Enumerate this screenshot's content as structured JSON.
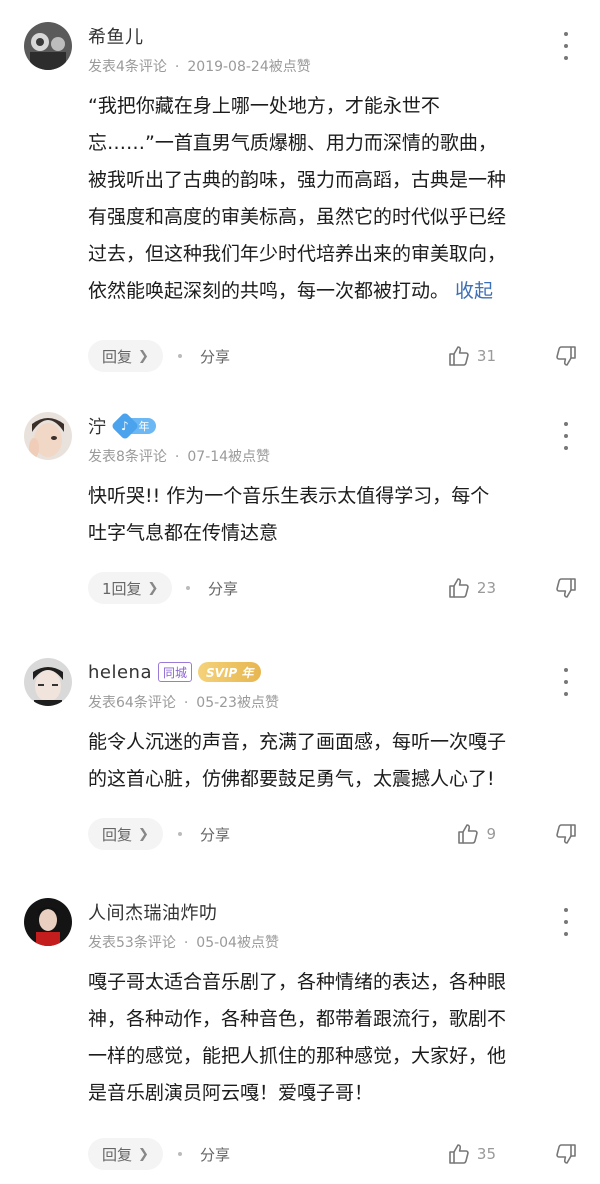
{
  "comments": [
    {
      "username": "希鱼儿",
      "meta": "发表4条评论",
      "date_likes": "2019-08-24被点赞",
      "lines": [
        "“我把你藏在身上哪一处地方，才能永世不",
        "忘……”一首直男气质爆棚、用力而深情的歌曲，",
        "被我听出了古典的韵味，强力而高蹈，古典是一种",
        "有强度和高度的审美标高，虽然它的时代似乎已经",
        "过去，但这种我们年少时代培养出来的审美取向，",
        "依然能唤起深刻的共鸣，每一次都被打动。"
      ],
      "collapse_label": "收起",
      "reply_label": "回复",
      "share_label": "分享",
      "likes": "31"
    },
    {
      "username": "泞",
      "badge_year": "年",
      "meta": "发表8条评论",
      "date_likes": "07-14被点赞",
      "lines": [
        "快听哭!! 作为一个音乐生表示太值得学习，每个",
        "吐字气息都在传情达意"
      ],
      "reply_label": "1回复",
      "share_label": "分享",
      "likes": "23"
    },
    {
      "username": "helena",
      "badge_city": "同城",
      "badge_svip": "SVIP 年",
      "meta": "发表64条评论",
      "date_likes": "05-23被点赞",
      "lines": [
        "能令人沉迷的声音，充满了画面感，每听一次嘎子",
        "的这首心脏，仿佛都要鼓足勇气，太震撼人心了!"
      ],
      "reply_label": "回复",
      "share_label": "分享",
      "likes": "9"
    },
    {
      "username": "人间杰瑞油炸叻",
      "meta": "发表53条评论",
      "date_likes": "05-04被点赞",
      "lines": [
        "嘎子哥太适合音乐剧了，各种情绪的表达，各种眼",
        "神，各种动作，各种音色，都带着跟流行，歌剧不",
        "一样的感觉，能把人抓住的那种感觉，大家好，他",
        "是音乐剧演员阿云嘎！爱嘎子哥！"
      ],
      "reply_label": "回复",
      "share_label": "分享",
      "likes": "35"
    }
  ],
  "icons": {
    "more": "more-vertical-icon",
    "like": "thumbs-up-icon",
    "dislike": "thumbs-down-icon",
    "chevron": "chevron-right-icon"
  }
}
